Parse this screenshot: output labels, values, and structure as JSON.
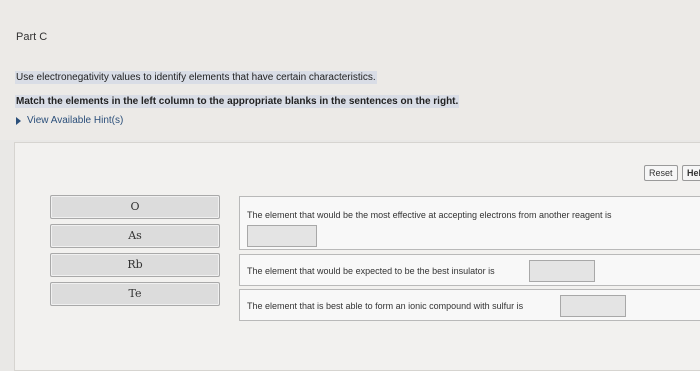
{
  "part": {
    "title": "Part C"
  },
  "instructions": {
    "line1": "Use electronegativity values to identify elements that have certain characteristics.",
    "line2": "Match the elements in the left column to the appropriate blanks in the sentences on the right."
  },
  "hints": {
    "label": "View Available Hint(s)"
  },
  "toolbar": {
    "reset_label": "Reset",
    "help_label": "Hel"
  },
  "elements": [
    "O",
    "As",
    "Rb",
    "Te"
  ],
  "sentences": [
    "The element that would be the most effective at accepting electrons from another reagent is",
    "The element that would be expected to be the best insulator is",
    "The element that is best able to form an ionic compound with sulfur is"
  ]
}
